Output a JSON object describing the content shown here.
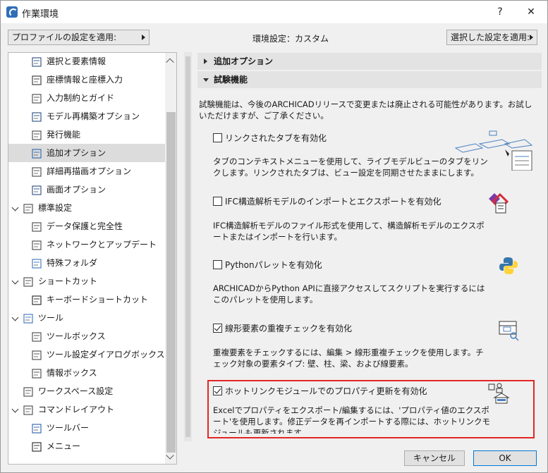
{
  "window": {
    "title": "作業環境",
    "help": "?",
    "close": "✕"
  },
  "topbar": {
    "profile_button": "プロファイルの設定を適用:",
    "env_setting": "環境設定：カスタム",
    "apply_selected": "選択した設定を適用:"
  },
  "sidebar": {
    "items": [
      {
        "label": "選択と要素情報",
        "icon": "selection-info-icon",
        "level": 2
      },
      {
        "label": "座標情報と座標入力",
        "icon": "xyz-coordinates-icon",
        "level": 2
      },
      {
        "label": "入力制約とガイド",
        "icon": "mouse-guide-icon",
        "level": 2
      },
      {
        "label": "モデル再構築オプション",
        "icon": "model-rebuild-icon",
        "level": 2
      },
      {
        "label": "発行機能",
        "icon": "publish-icon",
        "level": 2
      },
      {
        "label": "追加オプション",
        "icon": "more-options-icon",
        "level": 2,
        "selected": true
      },
      {
        "label": "詳細再描画オプション",
        "icon": "redraw-icon",
        "level": 2
      },
      {
        "label": "画面オプション",
        "icon": "screen-icon",
        "level": 2
      },
      {
        "label": "標準設定",
        "icon": "standard-settings-icon",
        "level": 1,
        "expanded": true
      },
      {
        "label": "データ保護と完全性",
        "icon": "data-safety-icon",
        "level": 2
      },
      {
        "label": "ネットワークとアップデート",
        "icon": "globe-icon",
        "level": 2
      },
      {
        "label": "特殊フォルダ",
        "icon": "folder-icon",
        "level": 2
      },
      {
        "label": "ショートカット",
        "icon": "shortcut-icon",
        "level": 1,
        "expanded": true
      },
      {
        "label": "キーボードショートカット",
        "icon": "keyboard-shortcut-icon",
        "level": 2
      },
      {
        "label": "ツール",
        "icon": "tools-icon",
        "level": 1,
        "expanded": true
      },
      {
        "label": "ツールボックス",
        "icon": "toolbox-icon",
        "level": 2
      },
      {
        "label": "ツール設定ダイアログボックス",
        "icon": "tool-settings-icon",
        "level": 2
      },
      {
        "label": "情報ボックス",
        "icon": "info-box-icon",
        "level": 2
      },
      {
        "label": "ワークスペース設定",
        "icon": "workspace-icon",
        "level": 1
      },
      {
        "label": "コマンドレイアウト",
        "icon": "command-layout-icon",
        "level": 1,
        "expanded": true
      },
      {
        "label": "ツールバー",
        "icon": "toolbar-icon",
        "level": 2
      },
      {
        "label": "メニュー",
        "icon": "menu-icon",
        "level": 2
      }
    ]
  },
  "main": {
    "section_more": "追加オプション",
    "section_experimental": "試験機能",
    "intro": "試験機能は、今後のARCHICADリリースで変更または廃止される可能性があります。お試しいただけますが、ご了承ください。",
    "features": [
      {
        "label": "リンクされたタブを有効化",
        "checked": false,
        "icon": "linked-tabs-icon",
        "desc": "タブのコンテキストメニューを使用して、ライブモデルビューのタブをリンクします。リンクされたタブは、ビュー設定を同期させたままにします。"
      },
      {
        "label": "IFC構造解析モデルのインポートとエクスポートを有効化",
        "checked": false,
        "icon": "ifc-structural-icon",
        "desc": "IFC構造解析モデルのファイル形式を使用して、構造解析モデルのエクスポートまたはインポートを行います。"
      },
      {
        "label": "Pythonパレットを有効化",
        "checked": false,
        "icon": "python-icon",
        "desc": "ARCHICADからPython APIに直接アクセスしてスクリプトを実行するにはこのパレットを使用します。"
      },
      {
        "label": "線形要素の重複チェックを有効化",
        "checked": true,
        "icon": "duplicate-check-icon",
        "desc": "重複要素をチェックするには、編集 > 線形重複チェックを使用します。チェック対象の要素タイプ: 壁、柱、梁、および線要素。"
      },
      {
        "label": "ホットリンクモジュールでのプロパティ更新を有効化",
        "checked": true,
        "icon": "hotlink-property-icon",
        "desc": "Excelでプロパティをエクスポート/編集するには、'プロパティ値のエクスポート'を使用します。修正データを再インポートする際には、ホットリンクモジュールも更新されます"
      }
    ]
  },
  "buttons": {
    "cancel": "キャンセル",
    "ok": "OK"
  },
  "colors": {
    "highlight": "#e32626",
    "ok_border": "#0078d7",
    "selected_bg": "#dcdcdc"
  }
}
